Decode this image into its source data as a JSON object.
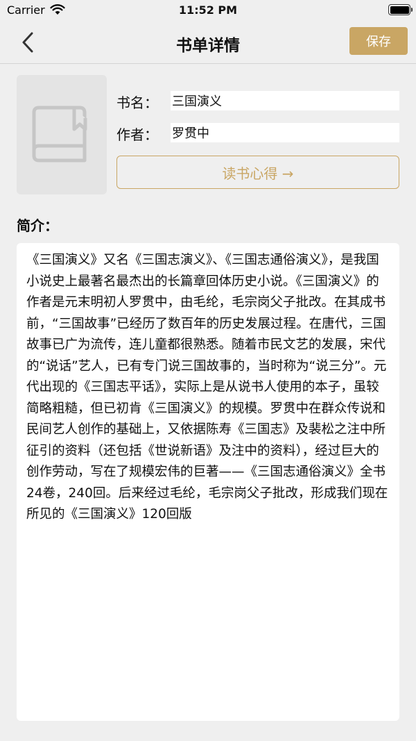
{
  "status_bar": {
    "carrier": "Carrier",
    "time": "11:52 PM",
    "battery_level": 1.0
  },
  "nav": {
    "title": "书单详情",
    "save_label": "保存",
    "accent_color": "#c9a664"
  },
  "book": {
    "title_label": "书名：",
    "title_value": "三国演义",
    "author_label": "作者：",
    "author_value": "罗贯中",
    "notes_button_label": "读书心得 →"
  },
  "intro": {
    "label": "简介：",
    "text": "《三国演义》又名《三国志演义》、《三国志通俗演义》，是我国小说史上最著名最杰出的长篇章回体历史小说。《三国演义》的作者是元末明初人罗贯中，由毛纶，毛宗岗父子批改。在其成书前，“三国故事”已经历了数百年的历史发展过程。在唐代，三国故事已广为流传，连儿童都很熟悉。随着市民文艺的发展，宋代的“说话”艺人，已有专门说三国故事的，当时称为“说三分”。元代出现的《三国志平话》，实际上是从说书人使用的本子，虽较简略粗糙，但已初肯《三国演义》的规模。罗贯中在群众传说和民间艺人创作的基础上，又依据陈寿《三国志》及裴松之注中所征引的资料（还包括《世说新语》及注中的资料），经过巨大的创作劳动，写在了规模宏伟的巨著——《三国志通俗演义》全书24卷，240回。后来经过毛纶，毛宗岗父子批改，形成我们现在所见的《三国演义》120回版"
  }
}
